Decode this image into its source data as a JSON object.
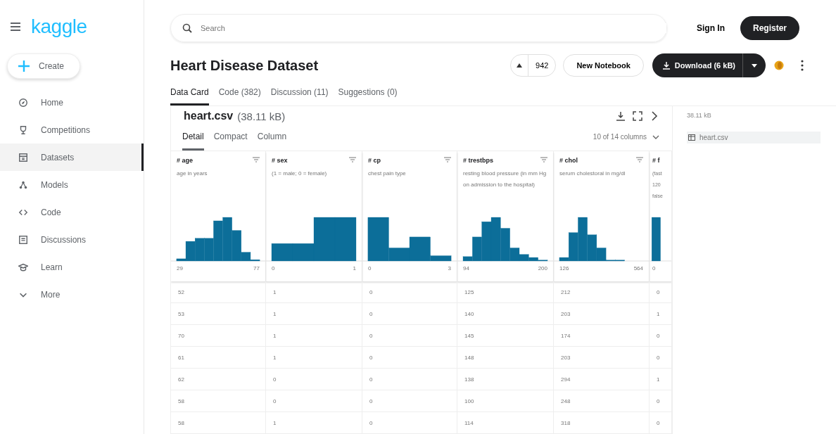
{
  "sidebar": {
    "logo": "kaggle",
    "create": "Create",
    "items": [
      {
        "label": "Home",
        "selected": false
      },
      {
        "label": "Competitions",
        "selected": false
      },
      {
        "label": "Datasets",
        "selected": true
      },
      {
        "label": "Models",
        "selected": false
      },
      {
        "label": "Code",
        "selected": false
      },
      {
        "label": "Discussions",
        "selected": false
      },
      {
        "label": "Learn",
        "selected": false
      },
      {
        "label": "More",
        "selected": false
      }
    ]
  },
  "search": {
    "placeholder": "Search"
  },
  "account": {
    "sign_in": "Sign In",
    "register": "Register"
  },
  "dataset": {
    "title": "Heart Disease Dataset",
    "votes": "942",
    "new_notebook": "New Notebook",
    "download": "Download (6 kB)"
  },
  "tabs": [
    {
      "label": "Data Card",
      "selected": true
    },
    {
      "label": "Code (382)",
      "selected": false
    },
    {
      "label": "Discussion (11)",
      "selected": false
    },
    {
      "label": "Suggestions (0)",
      "selected": false
    }
  ],
  "file": {
    "name": "heart.csv",
    "size": "(38.11 kB)",
    "view_tabs": [
      {
        "label": "Detail",
        "selected": true
      },
      {
        "label": "Compact",
        "selected": false
      },
      {
        "label": "Column",
        "selected": false
      }
    ],
    "columns_picker": "10 of 14 columns",
    "columns": [
      {
        "type": "#",
        "name": "age",
        "description": "age in years",
        "min": "29",
        "max": "77"
      },
      {
        "type": "#",
        "name": "sex",
        "description": "(1 = male; 0 = female)",
        "min": "0",
        "max": "1"
      },
      {
        "type": "#",
        "name": "cp",
        "description": "chest pain type",
        "min": "0",
        "max": "3"
      },
      {
        "type": "#",
        "name": "trestbps",
        "description": "resting blood pressure (in mm Hg on admission to the hospital)",
        "min": "94",
        "max": "200"
      },
      {
        "type": "#",
        "name": "chol",
        "description": "serum cholestoral in mg/dl",
        "min": "126",
        "max": "564"
      },
      {
        "type": "#",
        "name": "f",
        "description": "(fast 120 false",
        "min": "0"
      }
    ],
    "rows": [
      [
        "52",
        "1",
        "0",
        "125",
        "212",
        "0"
      ],
      [
        "53",
        "1",
        "0",
        "140",
        "203",
        "1"
      ],
      [
        "70",
        "1",
        "0",
        "145",
        "174",
        "0"
      ],
      [
        "61",
        "1",
        "0",
        "148",
        "203",
        "0"
      ],
      [
        "62",
        "0",
        "0",
        "138",
        "294",
        "1"
      ],
      [
        "58",
        "0",
        "0",
        "100",
        "248",
        "0"
      ],
      [
        "58",
        "1",
        "0",
        "114",
        "318",
        "0"
      ]
    ]
  },
  "side_panel": {
    "size": "38.11 kB",
    "files": [
      {
        "name": "heart.csv",
        "selected": true
      }
    ]
  }
}
